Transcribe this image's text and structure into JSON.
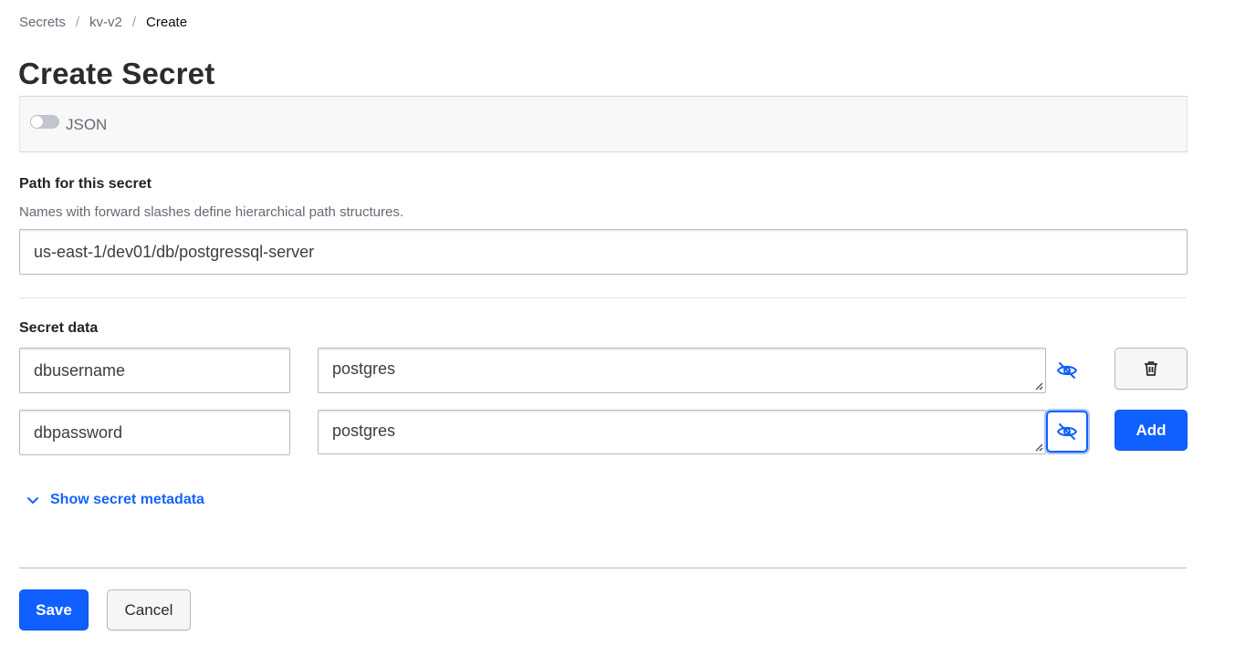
{
  "breadcrumb": {
    "items": [
      "Secrets",
      "kv-v2"
    ],
    "separator": "/",
    "current": "Create"
  },
  "page": {
    "title": "Create Secret"
  },
  "json_toggle": {
    "label": "JSON",
    "enabled": false
  },
  "path": {
    "label": "Path for this secret",
    "helper": "Names with forward slashes define hierarchical path structures.",
    "value": "us-east-1/dev01/db/postgressql-server"
  },
  "secret_data": {
    "label": "Secret data",
    "rows": [
      {
        "key": "dbusername",
        "value": "postgres",
        "action": "delete",
        "visibility_icon": "eye-slash-icon"
      },
      {
        "key": "dbpassword",
        "value": "postgres",
        "action": "Add",
        "visibility_icon": "eye-slash-icon"
      }
    ]
  },
  "metadata_toggle": {
    "label": "Show secret metadata",
    "icon": "chevron-down-icon"
  },
  "footer": {
    "save_label": "Save",
    "cancel_label": "Cancel"
  },
  "colors": {
    "primary": "#1060ff",
    "link": "#1563ff",
    "text": "#1f2328",
    "muted": "#656a76"
  }
}
